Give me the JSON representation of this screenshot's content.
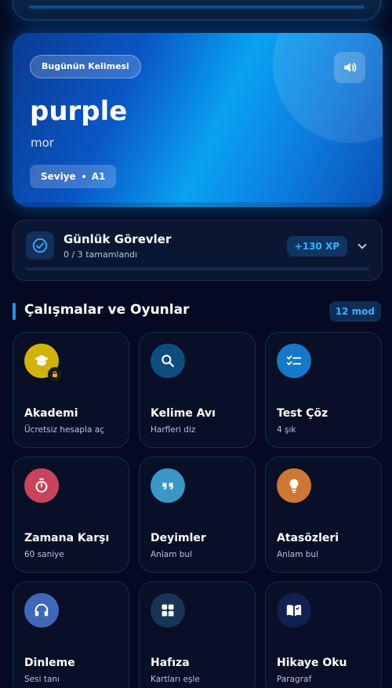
{
  "word_card": {
    "badge": "Bugünün Kelimesi",
    "word": "purple",
    "meaning": "mor",
    "level_label": "Seviye",
    "level_value": "A1"
  },
  "tasks": {
    "title": "Günlük Görevler",
    "subtitle": "0 / 3 tamamlandı",
    "xp": "+130 XP",
    "progress": 0
  },
  "section": {
    "title": "Çalışmalar ve Oyunlar",
    "count": "12 mod"
  },
  "tiles": [
    {
      "title": "Akademi",
      "sub": "Ücretsiz hesapla aç",
      "icon": "graduation-cap-icon",
      "color": "#d1b20b"
    },
    {
      "title": "Kelime Avı",
      "sub": "Harfleri diz",
      "icon": "search-icon",
      "color": "#0f4d7e"
    },
    {
      "title": "Test Çöz",
      "sub": "4 şık",
      "icon": "checklist-icon",
      "color": "#1678c8"
    },
    {
      "title": "Zamana Karşı",
      "sub": "60 saniye",
      "icon": "stopwatch-icon",
      "color": "#c9435d"
    },
    {
      "title": "Deyimler",
      "sub": "Anlam bul",
      "icon": "quote-icon",
      "color": "#3b97c8"
    },
    {
      "title": "Atasözleri",
      "sub": "Anlam bul",
      "icon": "lightbulb-icon",
      "color": "#cc7733"
    },
    {
      "title": "Dinleme",
      "sub": "Sesi tanı",
      "icon": "headphones-icon",
      "color": "#4168b8"
    },
    {
      "title": "Hafıza",
      "sub": "Kartları eşle",
      "icon": "grid-icon",
      "color": "#163556"
    },
    {
      "title": "Hikaye Oku",
      "sub": "Paragraf",
      "icon": "book-icon",
      "color": "#121f52"
    }
  ]
}
